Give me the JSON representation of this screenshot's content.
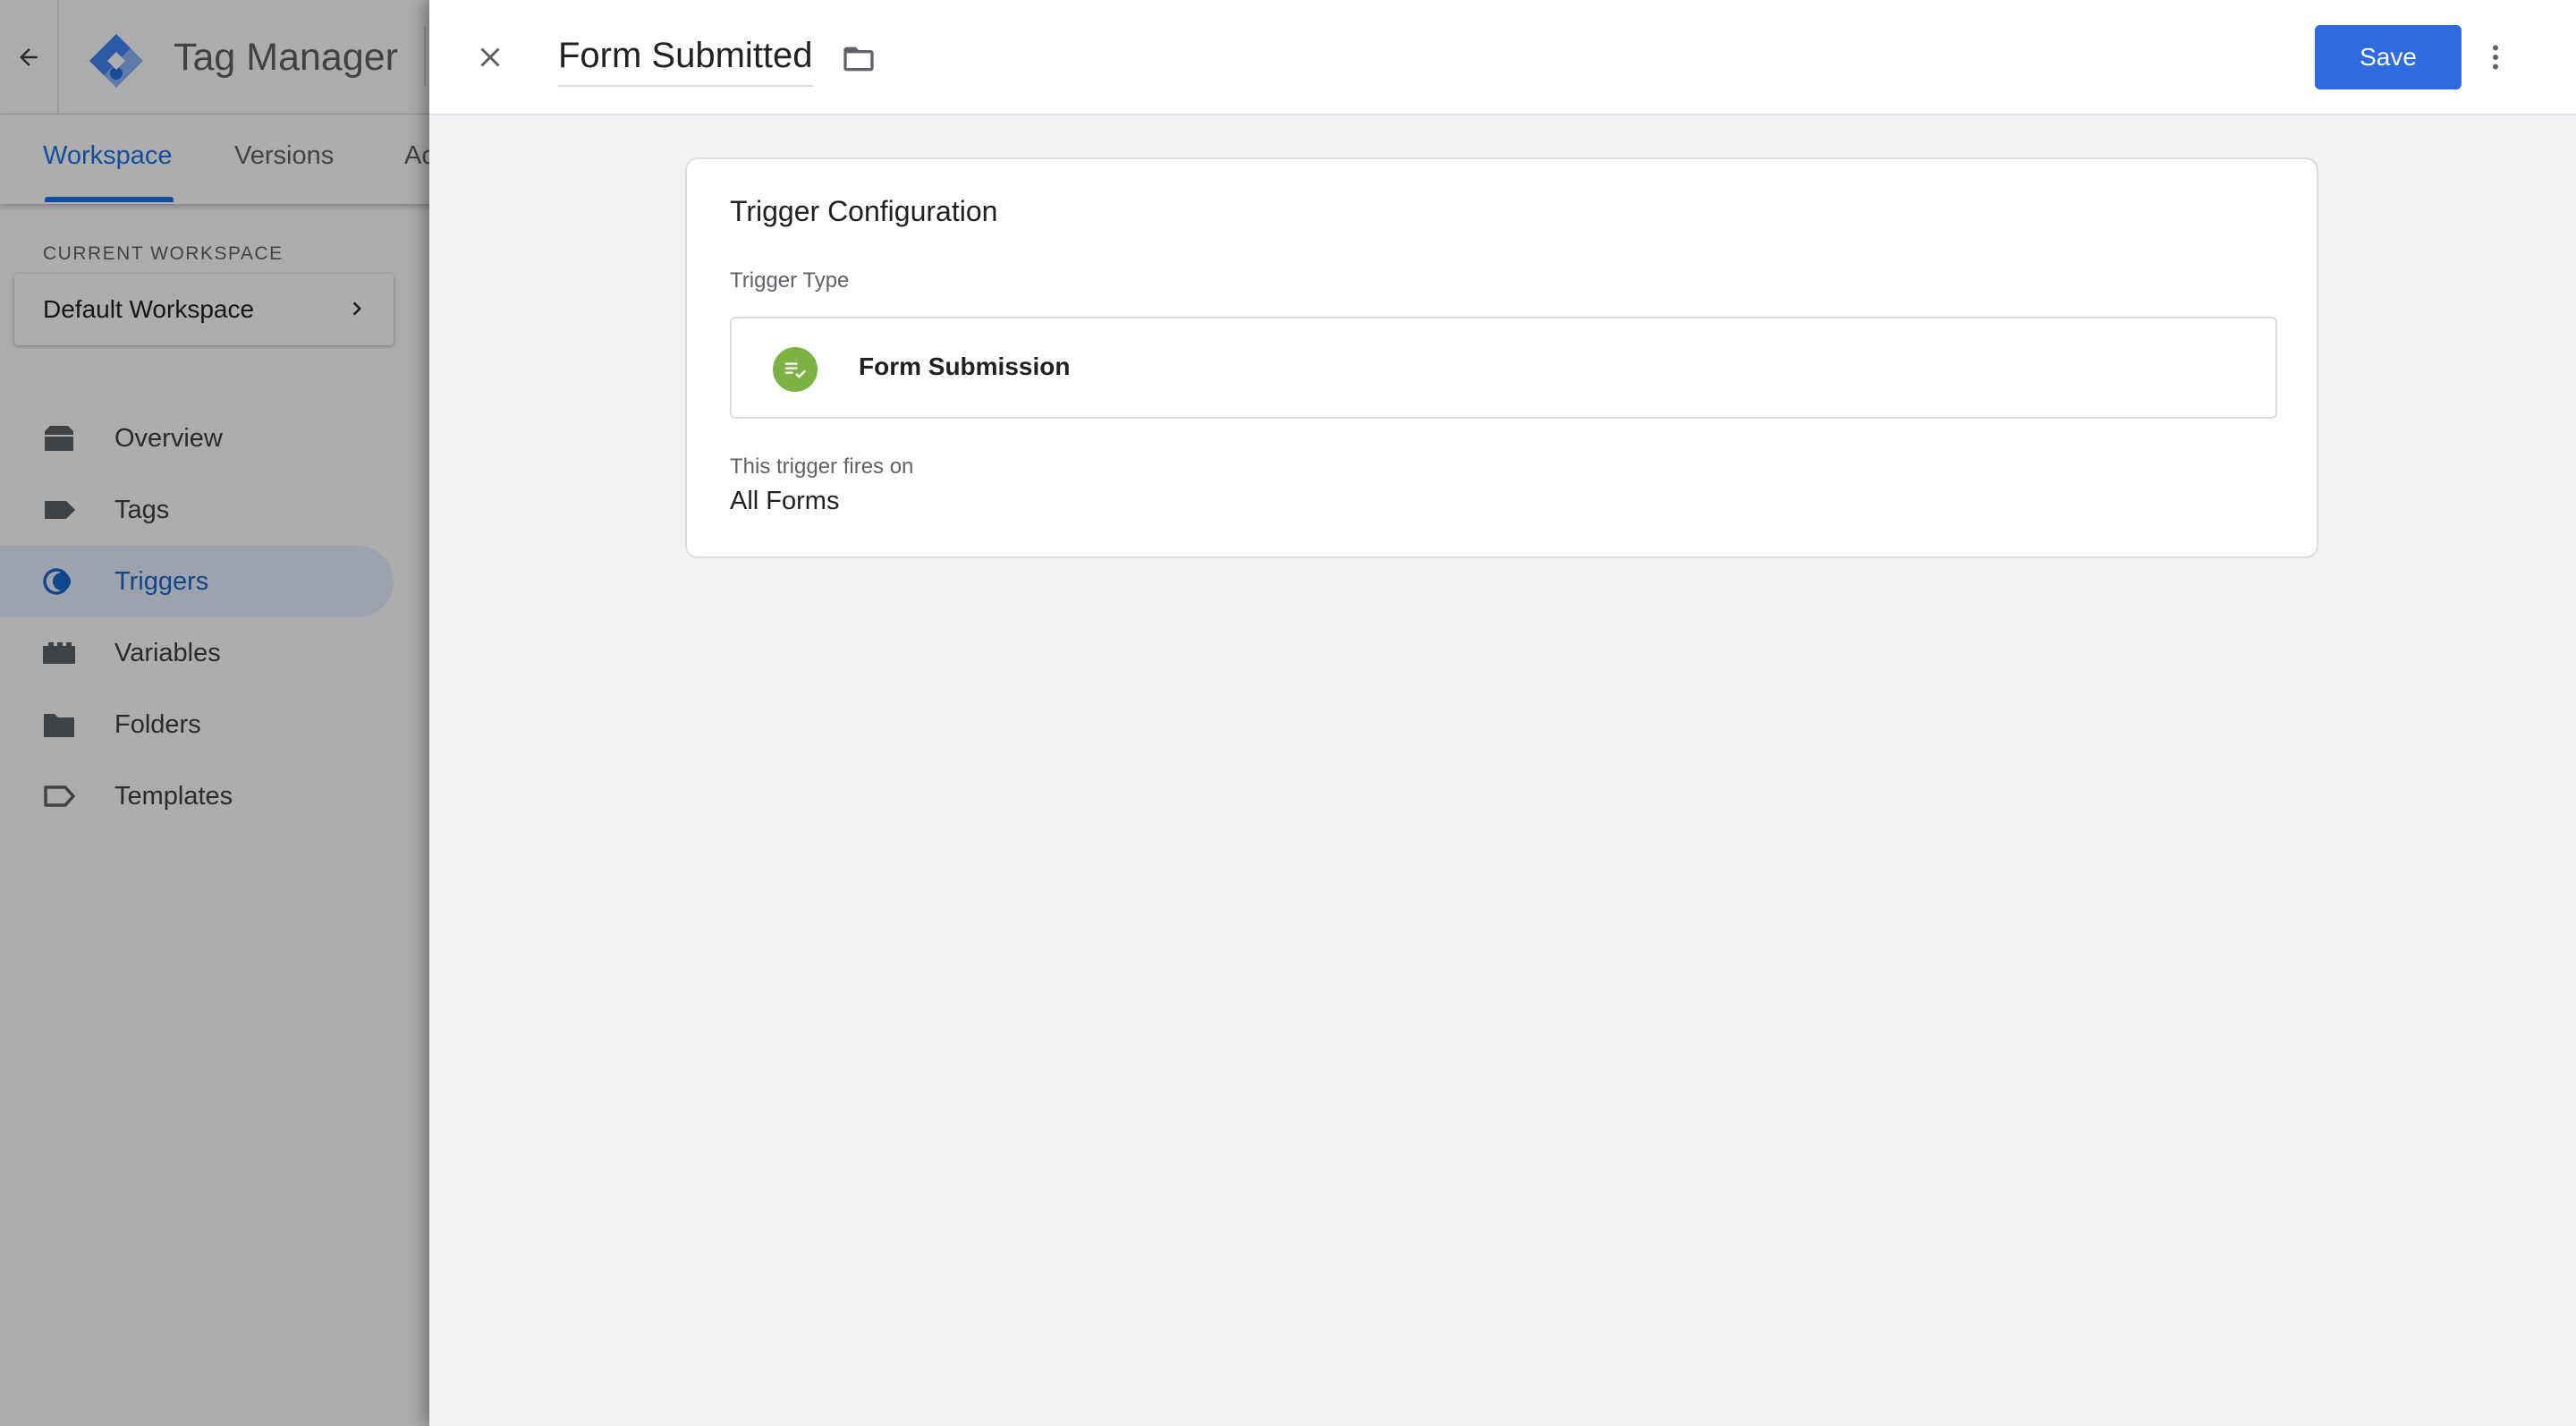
{
  "app": {
    "title": "Tag Manager",
    "tabs": [
      {
        "label": "Workspace",
        "active": true
      },
      {
        "label": "Versions",
        "active": false
      },
      {
        "label": "Ac",
        "active": false
      }
    ],
    "current_workspace": {
      "label": "CURRENT WORKSPACE",
      "name": "Default Workspace"
    },
    "nav": [
      {
        "label": "Overview",
        "icon": "overview-icon"
      },
      {
        "label": "Tags",
        "icon": "tag-icon"
      },
      {
        "label": "Triggers",
        "icon": "trigger-icon",
        "active": true
      },
      {
        "label": "Variables",
        "icon": "variables-icon"
      },
      {
        "label": "Folders",
        "icon": "folder-icon"
      },
      {
        "label": "Templates",
        "icon": "template-icon"
      }
    ]
  },
  "sheet": {
    "title": "Form Submitted",
    "save_label": "Save",
    "card": {
      "title": "Trigger Configuration",
      "trigger_type_label": "Trigger Type",
      "trigger_type": "Form Submission",
      "fires_on_label": "This trigger fires on",
      "fires_on_value": "All Forms"
    }
  },
  "colors": {
    "accent": "#1a73e8",
    "save_button": "#2d6bde",
    "trigger_type_icon": "#7cb342",
    "active_nav_bg": "#e8f0fe"
  }
}
